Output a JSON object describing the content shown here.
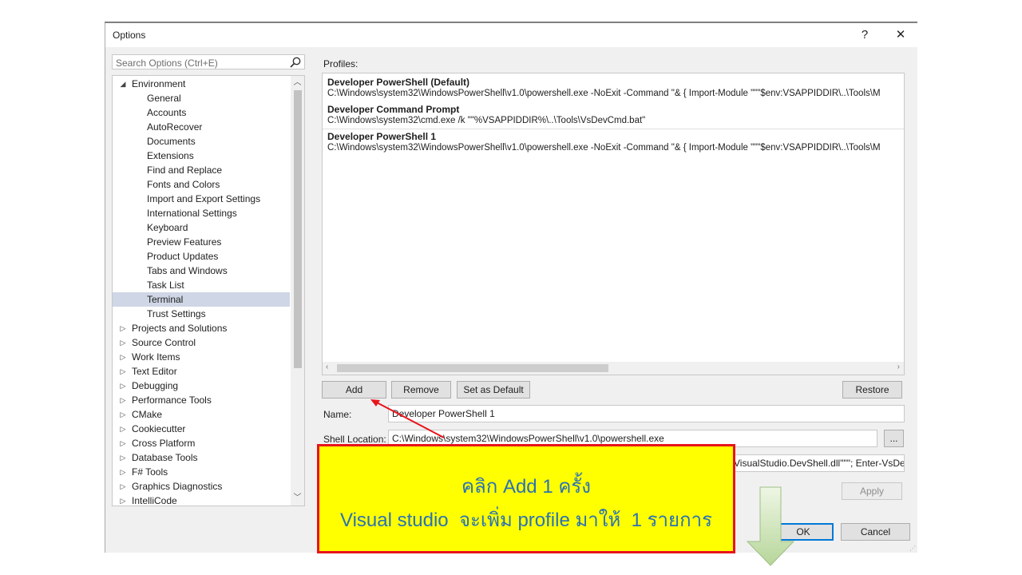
{
  "window": {
    "title": "Options",
    "help": "?",
    "close": "✕"
  },
  "search": {
    "placeholder": "Search Options (Ctrl+E)"
  },
  "tree": {
    "environment": "Environment",
    "children": [
      "General",
      "Accounts",
      "AutoRecover",
      "Documents",
      "Extensions",
      "Find and Replace",
      "Fonts and Colors",
      "Import and Export Settings",
      "International Settings",
      "Keyboard",
      "Preview Features",
      "Product Updates",
      "Tabs and Windows",
      "Task List",
      "Terminal",
      "Trust Settings"
    ],
    "selected": "Terminal",
    "collapsed": [
      "Projects and Solutions",
      "Source Control",
      "Work Items",
      "Text Editor",
      "Debugging",
      "Performance Tools",
      "CMake",
      "Cookiecutter",
      "Cross Platform",
      "Database Tools",
      "F# Tools",
      "Graphics Diagnostics",
      "IntelliCode"
    ]
  },
  "profiles_label": "Profiles:",
  "profiles": [
    {
      "name": "Developer PowerShell (Default)",
      "command": "C:\\Windows\\system32\\WindowsPowerShell\\v1.0\\powershell.exe -NoExit -Command \"& { Import-Module \"\"\"$env:VSAPPIDDIR\\..\\Tools\\M"
    },
    {
      "name": "Developer Command Prompt",
      "command": "C:\\Windows\\system32\\cmd.exe /k \"\"%VSAPPIDDIR%\\..\\Tools\\VsDevCmd.bat\""
    },
    {
      "name": "Developer PowerShell 1",
      "command": "C:\\Windows\\system32\\WindowsPowerShell\\v1.0\\powershell.exe -NoExit -Command \"& { Import-Module \"\"\"$env:VSAPPIDDIR\\..\\Tools\\M"
    }
  ],
  "buttons": {
    "add": "Add",
    "remove": "Remove",
    "set_default": "Set as Default",
    "restore": "Restore",
    "browse": "...",
    "apply": "Apply",
    "ok": "OK",
    "cancel": "Cancel"
  },
  "form": {
    "name_label": "Name:",
    "name_value": "Developer PowerShell 1",
    "shell_label": "Shell Location:",
    "shell_value": "C:\\Windows\\system32\\WindowsPowerShell\\v1.0\\powershell.exe",
    "args_value": "VisualStudio.DevShell.dll\"\"\"; Enter-VsDev"
  },
  "callout": {
    "line1": "คลิก Add 1 ครั้ง",
    "line2": "Visual studio  จะเพิ่ม profile มาให้  1 รายการ"
  },
  "colors": {
    "callout_bg": "#ffff00",
    "callout_border": "#e8141c",
    "callout_text": "#2a72b5",
    "arrow": "#e8141c",
    "ok_border": "#0078d7"
  }
}
